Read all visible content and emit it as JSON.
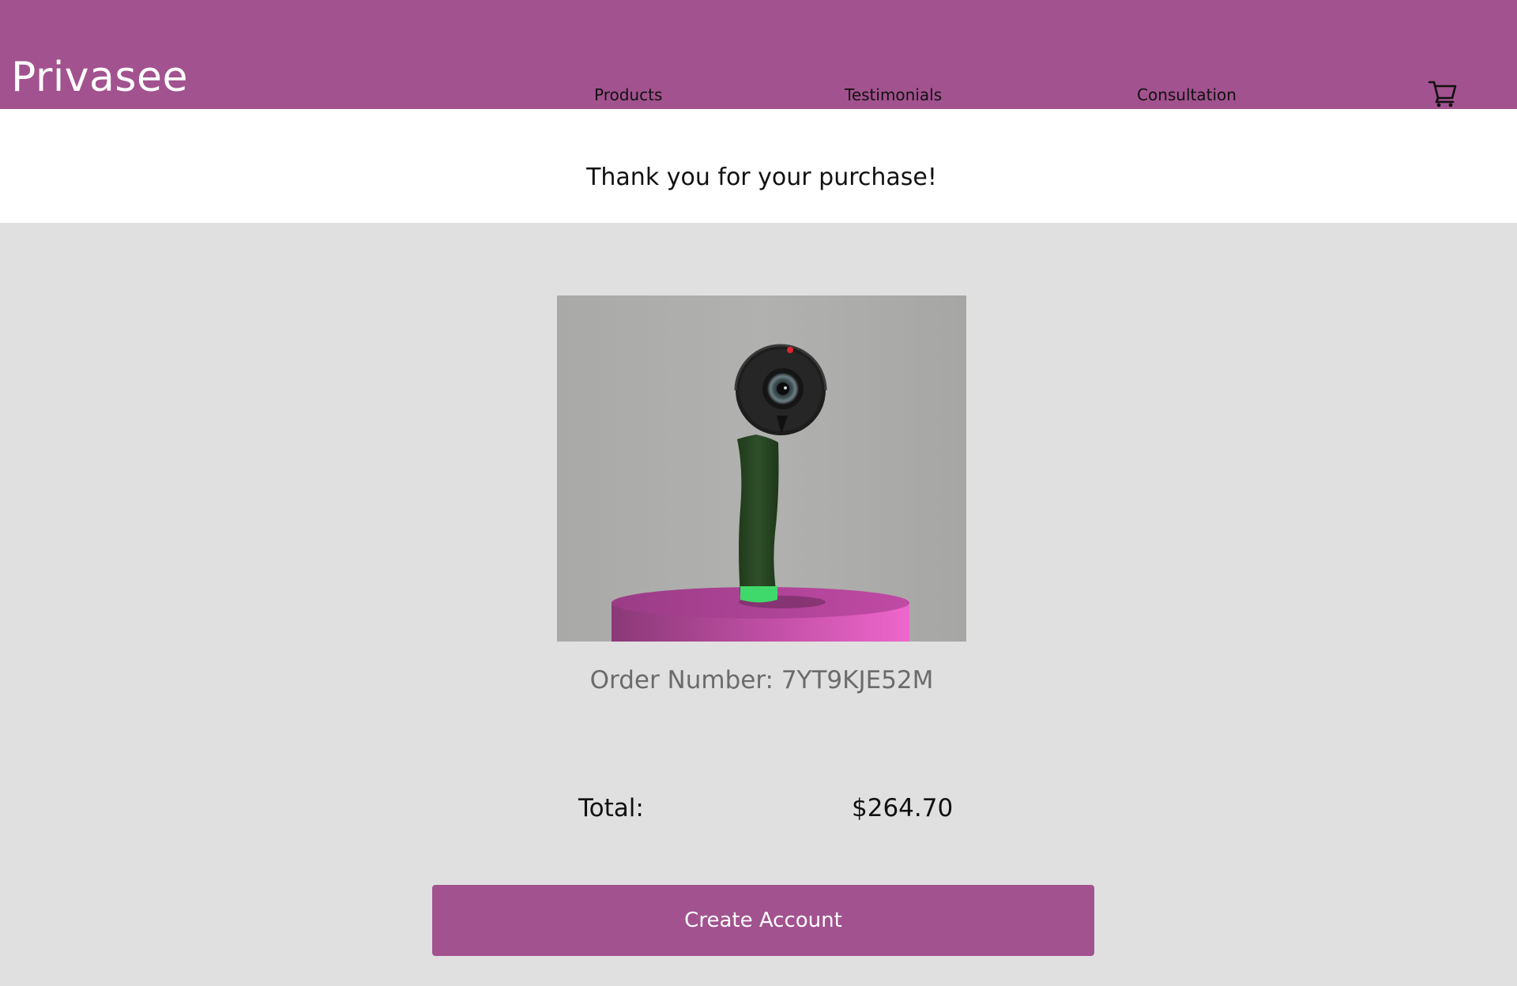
{
  "header": {
    "brand": "Privasee",
    "nav": {
      "products": "Products",
      "testimonials": "Testimonials",
      "consultation": "Consultation"
    },
    "cart_icon": "shopping-cart-icon"
  },
  "confirmation": {
    "message": "Thank you for your purchase!",
    "order_number_text": "Order Number: 7YT9KJE52M",
    "total_label": "Total:",
    "total_value": "$264.70",
    "create_account_label": "Create Account"
  },
  "colors": {
    "brand": "#a2528f",
    "band": "#ffffff",
    "background": "#e0e0e0"
  }
}
